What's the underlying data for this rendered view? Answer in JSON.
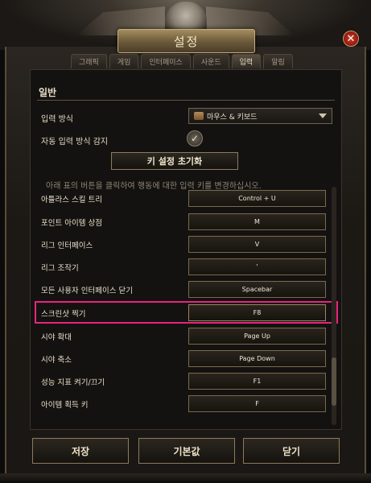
{
  "window": {
    "title": "설정",
    "close_label": "✕"
  },
  "tabs": [
    {
      "label": "그래픽",
      "active": false
    },
    {
      "label": "게임",
      "active": false
    },
    {
      "label": "인터페이스",
      "active": false
    },
    {
      "label": "사운드",
      "active": false
    },
    {
      "label": "입력",
      "active": true
    },
    {
      "label": "알림",
      "active": false
    }
  ],
  "section": {
    "title": "일반"
  },
  "input_method": {
    "label": "입력 방식",
    "value": "마우스 & 키보드"
  },
  "auto_detect": {
    "label": "자동 입력 방식 감지",
    "checked": true,
    "check_glyph": "✓"
  },
  "reset_button": {
    "label": "키 설정 초기화"
  },
  "hint": "아래 표의 버튼을 클릭하여 행동에 대한 입력 키를 변경하십시오.",
  "keybinds": [
    {
      "label": "아틀라스 스킬 트리",
      "key": "Control + U"
    },
    {
      "label": "포인트 아이템 상점",
      "key": "M"
    },
    {
      "label": "리그 인터페이스",
      "key": "V"
    },
    {
      "label": "리그 조작기",
      "key": "'"
    },
    {
      "label": "모든 사용자 인터페이스 닫기",
      "key": "Spacebar"
    },
    {
      "label": "스크린샷 찍기",
      "key": "F8",
      "highlighted": true
    },
    {
      "label": "시야 확대",
      "key": "Page Up"
    },
    {
      "label": "시야 축소",
      "key": "Page Down"
    },
    {
      "label": "성능 지표 켜기/끄기",
      "key": "F1"
    },
    {
      "label": "아이템 획득 키",
      "key": "F"
    }
  ],
  "bottom": {
    "save": "저장",
    "defaults": "기본값",
    "close": "닫기"
  },
  "colors": {
    "highlight": "#e8247d",
    "gold_border": "#8c7b5d",
    "close_red": "#d23a2a"
  }
}
